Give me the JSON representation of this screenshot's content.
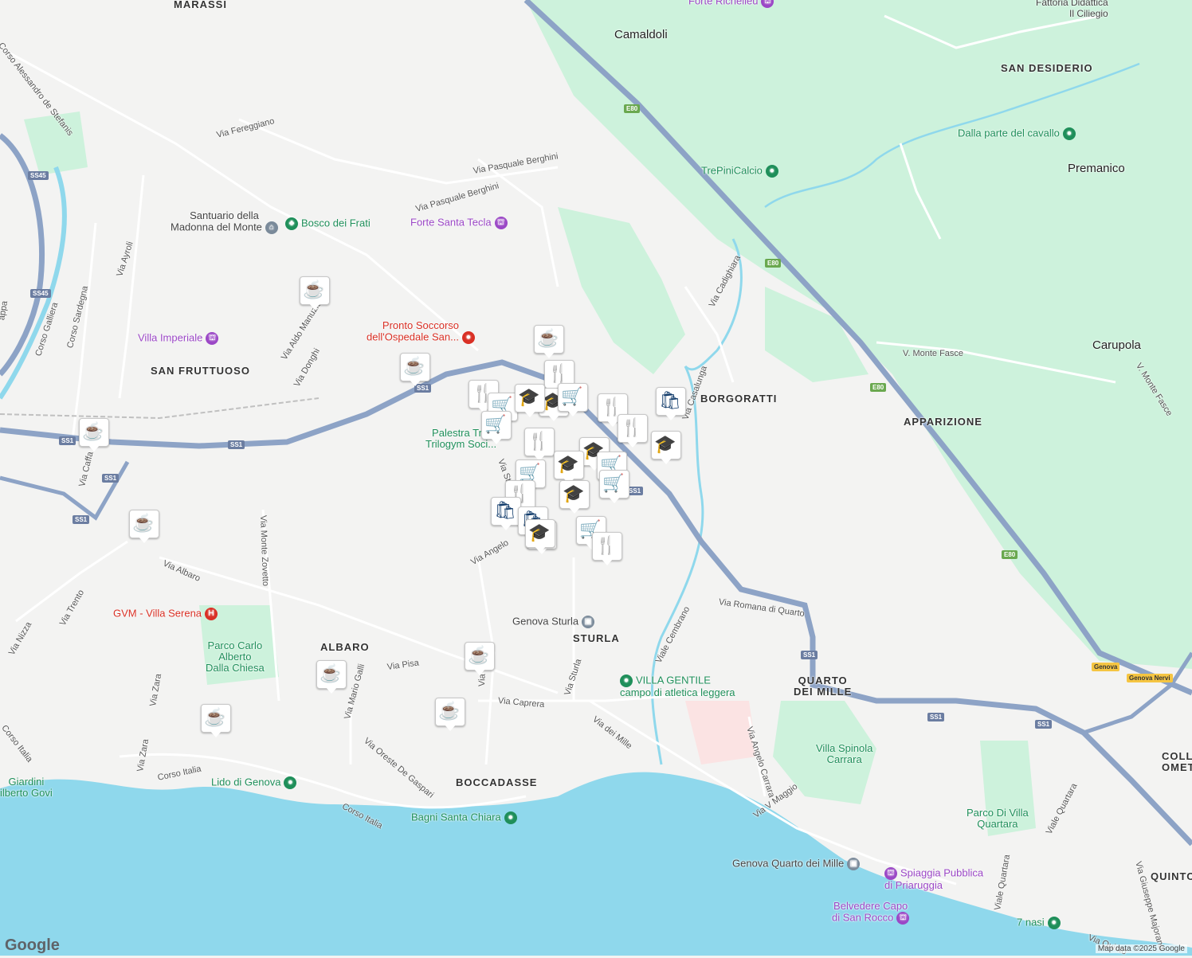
{
  "map": {
    "attribution": "Map data ©2025 Google",
    "logo": "Google",
    "colors": {
      "land": "#f3f3f2",
      "sea": "#8fd8ec",
      "park": "#cdf2dc",
      "highway": "#8da3c6",
      "road": "#ffffff",
      "marker_glyph": "#123c6b"
    }
  },
  "labels": {
    "marassi": "MARASSI",
    "camaldoli": "Camaldoli",
    "forte_richelieu": "Forte Richelieu",
    "fattoria": "Fattoria Didattica\nIl Ciliegio",
    "san_desiderio": "SAN DESIDERIO",
    "dalla_parte": "Dalla parte del cavallo",
    "premanico": "Premanico",
    "trepinicalcio": "TrePiniCalcio",
    "carupola": "Carupola",
    "v_monte_fasce_1": "V. Monte Fasce",
    "v_monte_fasce_2": "V. Monte Fasce",
    "apparizione": "APPARIZIONE",
    "borgoratti": "BORGORATTI",
    "corso_de_stefanis": "Corso Alessandro de Stefanis",
    "via_fereggiano": "Via Fereggiano",
    "via_pasquale_berghini_1": "Via Pasquale Berghini",
    "via_pasquale_berghini_2": "Via Pasquale Berghini",
    "santuario": "Santuario della\nMadonna del Monte",
    "bosco_dei_frati": "Bosco dei Frati",
    "forte_santa_tecla": "Forte Santa Tecla",
    "via_ayroli": "Via Ayroli",
    "pronto_soccorso": "Pronto Soccorso\ndell'Ospedale San...",
    "villa_imperiale": "Villa Imperiale",
    "via_aldo_manuzio": "Via Aldo Manuzio",
    "via_donghi": "Via Donghi",
    "san_fruttuoso": "SAN FRUTTUOSO",
    "corso_galliera": "Corso Galliera",
    "corso_sardegna": "Corso Sardegna",
    "palestra": "Palestra Tr...\nTrilogym Soci...",
    "via_cadighiara": "Via Cadighiara",
    "via_casalunga": "Via Casalunga",
    "via_sturla_1": "Via Sturla",
    "via_angelo": "Via Angelo",
    "via_monte_zovetto": "Via Monte Zovetto",
    "via_albaro": "Via Albaro",
    "via_trento": "Via Trento",
    "via_nizza": "Via Nizza",
    "gvm": "GVM - Villa Serena",
    "parco_carlo": "Parco Carlo\nAlberto\nDalla Chiesa",
    "albaro": "ALBARO",
    "via_pisa": "Via Pisa",
    "via_mario_galli": "Via Mario Galli",
    "via_zara_1": "Via Zara",
    "via_zara_2": "Via Zara",
    "genova_sturla": "Genova Sturla",
    "sturla": "STURLA",
    "via_sturla_2": "Via Sturla",
    "via_caprera": "Via Caprera",
    "via_orsini": "Via Orsini",
    "via_dei_mille": "Via dei Mille",
    "viale_cembrano": "Viale Cembrano",
    "via_romana": "Via Romana di Quarto",
    "villa_gentile": "VILLA GENTILE\ncampo di atletica leggera",
    "quarto_dei_mille": "QUARTO\nDEI MILLE",
    "via_angelo_carrara": "Via Angelo Carrara",
    "villa_spinola": "Villa Spinola\nCarrara",
    "colle": "COLLE DE\nOMETT",
    "parco_quartara": "Parco Di Villa\nQuartara",
    "viale_quartara_1": "Viale Quartara",
    "viale_quartara_2": "Viale Quartara",
    "via_giuseppe_majorana": "Via Giuseppe Majorana",
    "quinto": "QUINTO",
    "corso_italia_1": "Corso Italia",
    "corso_italia_2": "Corso Italia",
    "corso_italia_3": "Corso Italia",
    "giardini": "Giardini\nilberto Govi",
    "lido": "Lido di Genova",
    "via_oreste": "Via Oreste De Gaspari",
    "boccadasse": "BOCCADASSE",
    "bagni": "Bagni Santa Chiara",
    "via_v_maggio": "Via V Maggio",
    "genova_quarto": "Genova Quarto dei Mille",
    "spiaggia": "Spiaggia Pubblica\ndi Priaruggia",
    "belvedere": "Belvedere Capo\ndi San Rocco",
    "sette_nasi": "7 nasi",
    "via_quinto": "Via Quinto",
    "via_cafi": "Via Caffa",
    "via_coppa": "appa"
  },
  "shields": {
    "e80_1": "E80",
    "e80_2": "E80",
    "e80_3": "E80",
    "e80_4": "E80",
    "ss1_1": "SS1",
    "ss1_2": "SS1",
    "ss1_3": "SS1",
    "ss1_4": "SS1",
    "ss1_5": "SS1",
    "ss1_6": "SS1",
    "ss1_7": "SS1",
    "ss1_8": "SS1",
    "ss1_9": "SS1",
    "ss45_1": "SS45",
    "ss45_2": "SS45",
    "genova": "Genova",
    "genova_nervi": "Genova Nervi"
  },
  "markers": [
    {
      "type": "cafe",
      "glyph": "☕"
    },
    {
      "type": "cafe",
      "glyph": "☕"
    },
    {
      "type": "cafe",
      "glyph": "☕"
    },
    {
      "type": "cafe",
      "glyph": "☕"
    },
    {
      "type": "cafe",
      "glyph": "☕"
    },
    {
      "type": "cafe",
      "glyph": "☕"
    },
    {
      "type": "cafe",
      "glyph": "☕"
    },
    {
      "type": "cafe",
      "glyph": "☕"
    },
    {
      "type": "cafe",
      "glyph": "☕"
    },
    {
      "type": "restaurant",
      "glyph": "🍴"
    },
    {
      "type": "grocery",
      "glyph": "🛒"
    },
    {
      "type": "restaurant",
      "glyph": "🍴"
    },
    {
      "type": "school",
      "glyph": "🎓"
    },
    {
      "type": "grocery",
      "glyph": "🛒"
    },
    {
      "type": "school",
      "glyph": "🎓"
    },
    {
      "type": "grocery",
      "glyph": "🛒"
    },
    {
      "type": "restaurant",
      "glyph": "🍴"
    },
    {
      "type": "restaurant",
      "glyph": "🍴"
    },
    {
      "type": "shopping",
      "glyph": "🛍"
    },
    {
      "type": "restaurant",
      "glyph": "🍴"
    },
    {
      "type": "school",
      "glyph": "🎓"
    },
    {
      "type": "school",
      "glyph": "🎓"
    },
    {
      "type": "grocery",
      "glyph": "🛒"
    },
    {
      "type": "school",
      "glyph": "🎓"
    },
    {
      "type": "school",
      "glyph": "🎓"
    },
    {
      "type": "grocery",
      "glyph": "🛒"
    },
    {
      "type": "grocery",
      "glyph": "🛒"
    },
    {
      "type": "restaurant",
      "glyph": "🍴"
    },
    {
      "type": "school",
      "glyph": "🎓"
    },
    {
      "type": "shopping",
      "glyph": "🛍"
    },
    {
      "type": "shopping",
      "glyph": "🛍"
    },
    {
      "type": "school",
      "glyph": "🎓"
    },
    {
      "type": "grocery",
      "glyph": "🛒"
    },
    {
      "type": "restaurant",
      "glyph": "🍴"
    }
  ]
}
